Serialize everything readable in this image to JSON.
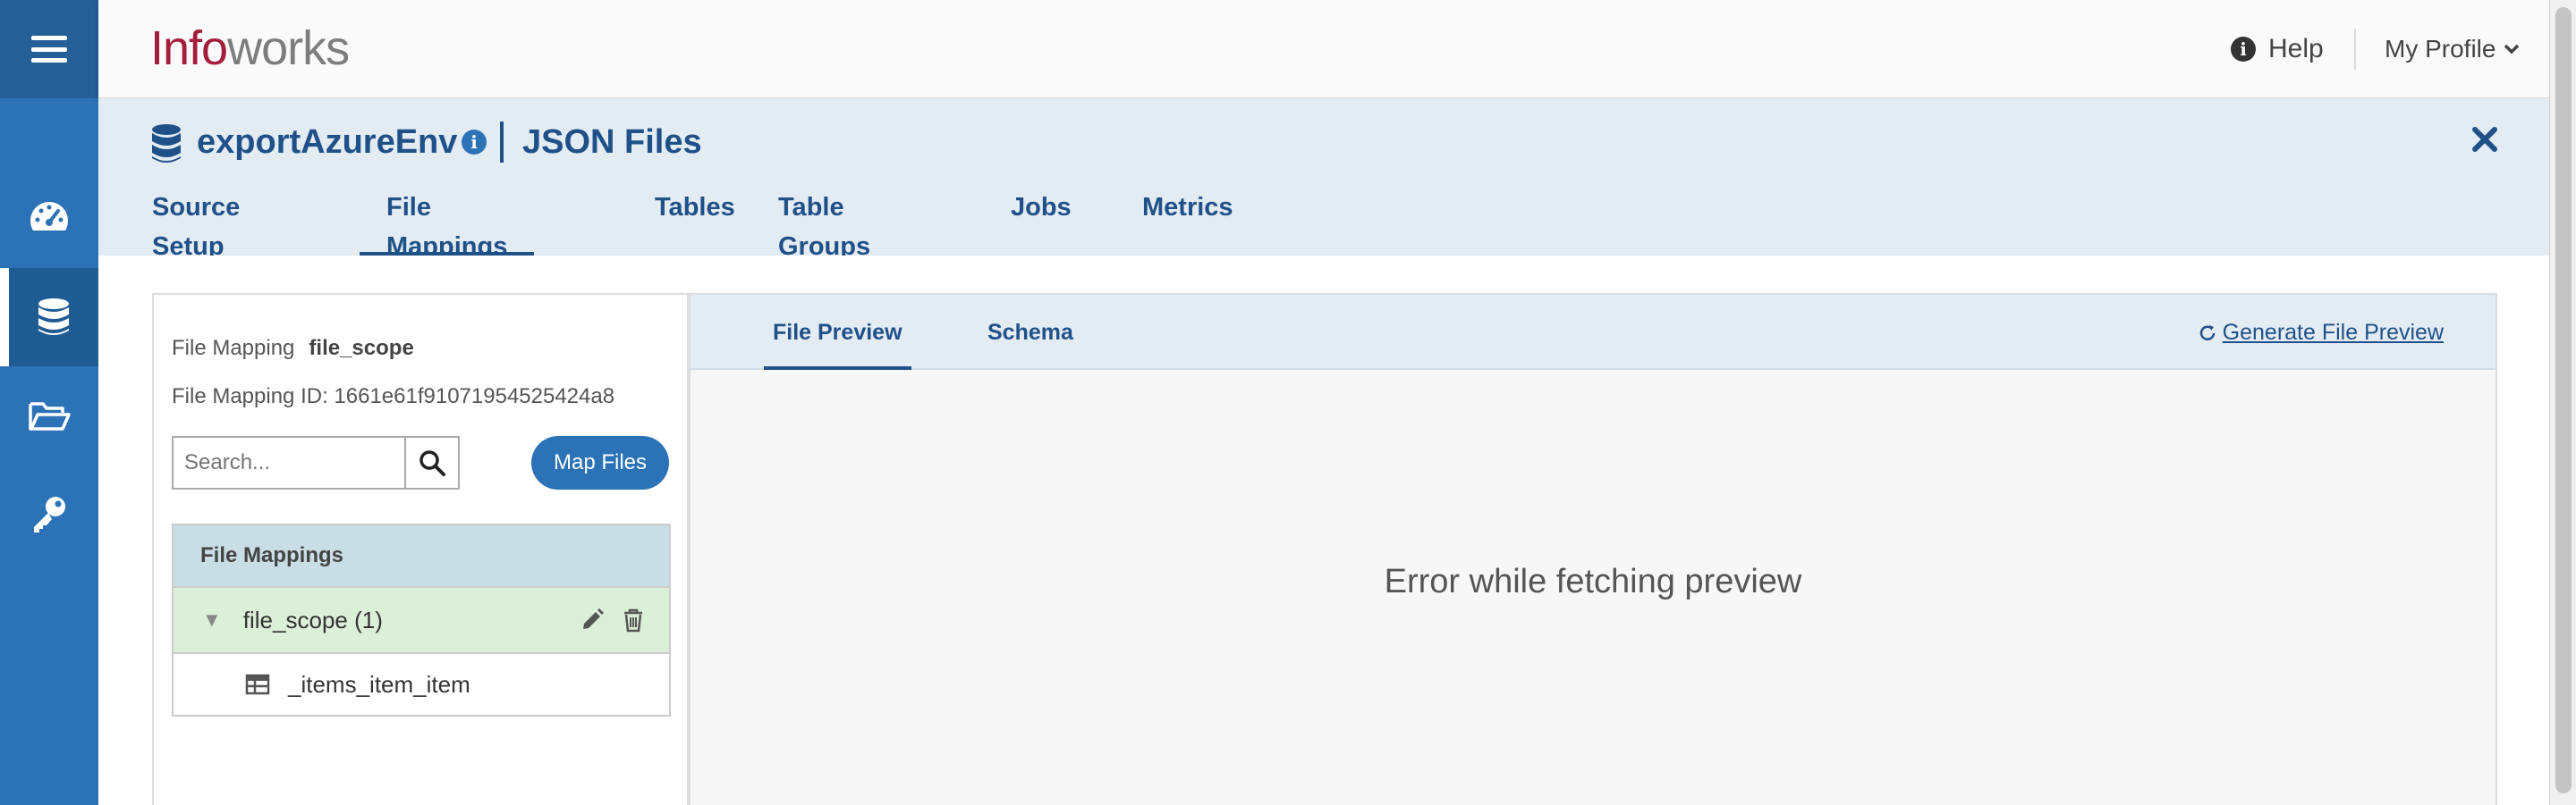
{
  "app": {
    "logo_part1": "Info",
    "logo_part2": "works",
    "help_label": "Help",
    "profile_label": "My Profile"
  },
  "sidebar": {
    "items": [
      {
        "icon": "dashboard-icon",
        "active": false
      },
      {
        "icon": "database-icon",
        "active": true
      },
      {
        "icon": "folder-open-icon",
        "active": false
      },
      {
        "icon": "key-icon",
        "active": false
      }
    ]
  },
  "header": {
    "source_name": "exportAzureEnv",
    "subtitle": "JSON Files",
    "tabs": [
      {
        "label": "Source Setup",
        "active": false
      },
      {
        "label": "File Mappings",
        "active": true
      },
      {
        "label": "Tables",
        "active": false
      },
      {
        "label": "Table Groups",
        "active": false
      },
      {
        "label": "Jobs",
        "active": false
      },
      {
        "label": "Metrics",
        "active": false
      }
    ]
  },
  "left_panel": {
    "file_mapping_label": "File Mapping",
    "file_mapping_value": "file_scope",
    "file_mapping_id": "File Mapping ID: 1661e61f91071954525424a8",
    "search_placeholder": "Search...",
    "map_files_label": "Map Files",
    "tree": {
      "header": "File Mappings",
      "items": [
        {
          "label": "file_scope (1)",
          "children": [
            "_items_item_item"
          ]
        }
      ]
    }
  },
  "right_panel": {
    "tabs": [
      {
        "label": "File Preview",
        "active": true
      },
      {
        "label": "Schema",
        "active": false
      }
    ],
    "generate_label": "Generate File Preview",
    "message": "Error while fetching preview"
  },
  "colors": {
    "accent": "#2b73b6",
    "header_text": "#1f5188",
    "logo_red": "#a51d3c",
    "tree_selected": "#dcefd8"
  }
}
